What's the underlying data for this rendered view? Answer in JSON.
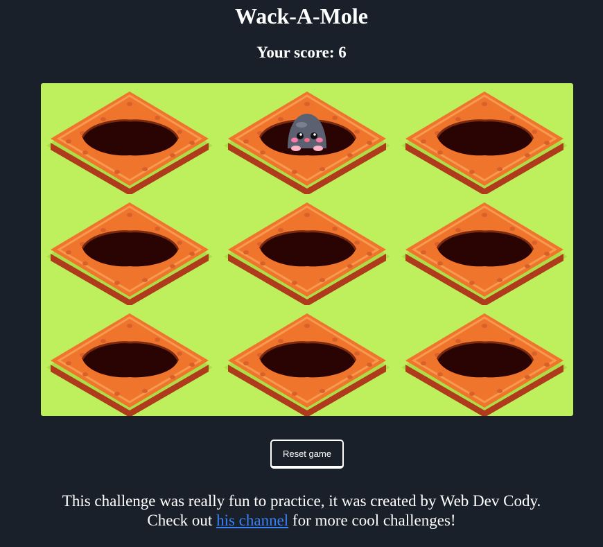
{
  "game": {
    "title": "Wack-A-Mole",
    "score_label": "Your score:",
    "score": 6,
    "reset_label": "Reset game",
    "mole_cell": 1,
    "grid": {
      "rows": 3,
      "columns": 3
    }
  },
  "footer": {
    "line1": "This challenge was really fun to practice, it was created by Web Dev Cody.",
    "line2_before": "Check out",
    "link_text": "his channel",
    "line2_after": "for more cool challenges!"
  },
  "colors": {
    "background": "#1a202a",
    "grass": "#bdf05c",
    "dirt": "#f0752c",
    "dirt_dark": "#b03a1c",
    "hole": "#2a0303",
    "mole": "#5b6170",
    "link": "#3b82f6"
  },
  "icons": {
    "hole": "dirt-hole-icon",
    "mole": "mole-icon"
  }
}
